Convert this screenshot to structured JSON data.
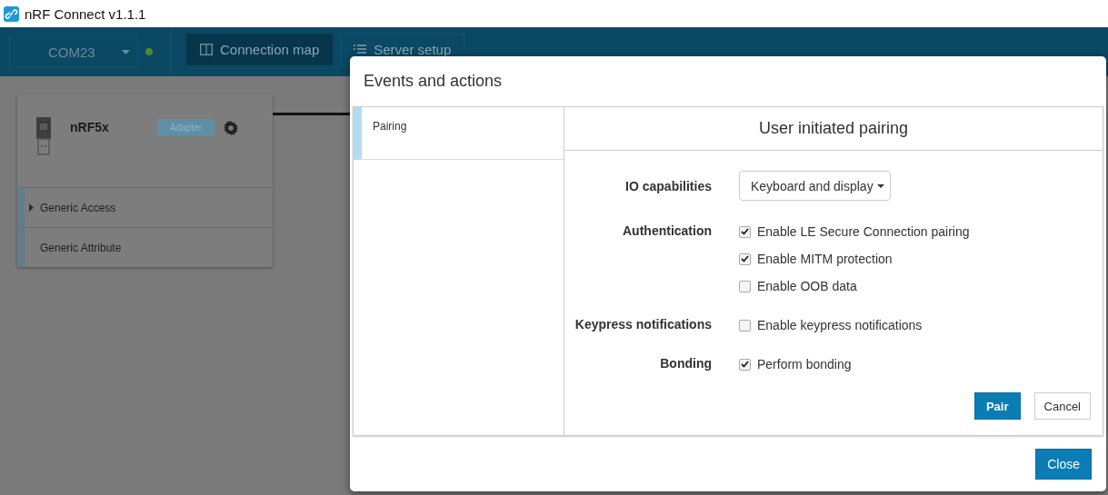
{
  "title_bar": {
    "title": "nRF Connect v1.1.1"
  },
  "toolbar": {
    "port": "COM23",
    "connected": true,
    "tabs": [
      {
        "label": "Connection map",
        "selected": true
      },
      {
        "label": "Server setup",
        "selected": false
      }
    ]
  },
  "device_card": {
    "name": "nRF5x",
    "badge": "Adapter",
    "services": [
      {
        "name": "Generic Access",
        "expandable": true
      },
      {
        "name": "Generic Attribute",
        "expandable": false
      }
    ]
  },
  "dialog": {
    "title": "Events and actions",
    "sidebar": [
      {
        "label": "Pairing",
        "selected": true
      }
    ],
    "panel": {
      "title": "User initiated pairing",
      "rows": [
        {
          "label": "IO capabilities",
          "kind": "dropdown",
          "value": "Keyboard and display"
        },
        {
          "label": "Authentication",
          "kind": "checkboxes",
          "options": [
            {
              "label": "Enable LE Secure Connection pairing",
              "checked": true
            },
            {
              "label": "Enable MITM protection",
              "checked": true
            },
            {
              "label": "Enable OOB data",
              "checked": false
            }
          ]
        },
        {
          "label": "Keypress notifications",
          "kind": "checkboxes",
          "options": [
            {
              "label": "Enable keypress notifications",
              "checked": false
            }
          ]
        },
        {
          "label": "Bonding",
          "kind": "checkboxes",
          "options": [
            {
              "label": "Perform bonding",
              "checked": true
            }
          ]
        }
      ],
      "buttons": [
        {
          "label": "Pair",
          "kind": "primary"
        },
        {
          "label": "Cancel",
          "kind": "default"
        }
      ]
    },
    "close": "Close"
  }
}
